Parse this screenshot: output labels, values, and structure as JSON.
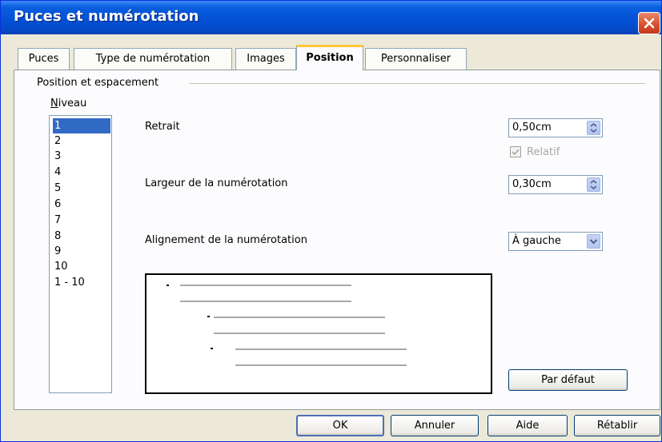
{
  "window": {
    "title": "Puces et numérotation"
  },
  "tabs": [
    {
      "label": "Puces",
      "active": false
    },
    {
      "label": "Type de numérotation",
      "active": false
    },
    {
      "label": "Images",
      "active": false
    },
    {
      "label": "Position",
      "active": true
    },
    {
      "label": "Personnaliser",
      "active": false
    }
  ],
  "group": {
    "label": "Position et espacement"
  },
  "level": {
    "label": "Niveau",
    "items": [
      "1",
      "2",
      "3",
      "4",
      "5",
      "6",
      "7",
      "8",
      "9",
      "10",
      "1 - 10"
    ],
    "selected": "1"
  },
  "indent": {
    "label": "Retrait",
    "value": "0,50cm"
  },
  "relative": {
    "label": "Relatif",
    "checked": true,
    "enabled": false
  },
  "numbering_width": {
    "label": "Largeur de la numérotation",
    "value": "0,30cm"
  },
  "numbering_alignment": {
    "label": "Alignement de la numérotation",
    "value": "À gauche"
  },
  "buttons": {
    "default": "Par défaut",
    "ok": "OK",
    "cancel": "Annuler",
    "help": "Aide",
    "reset": "Rétablir"
  },
  "colors": {
    "titlebar": "#0553d8",
    "dialog_bg": "#ece9d8",
    "selection": "#316ac5",
    "active_tab_accent": "#ffc83c",
    "close_button": "#d8532f"
  },
  "icons": [
    "close-icon",
    "spin-arrows-icon",
    "dropdown-arrow-icon",
    "checkmark-icon"
  ]
}
